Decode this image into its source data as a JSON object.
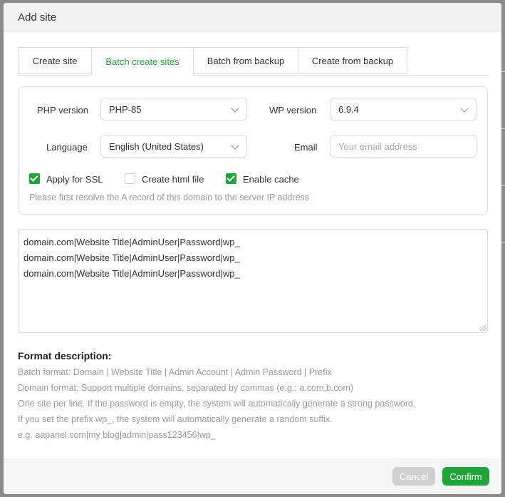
{
  "dialog": {
    "title": "Add site"
  },
  "tabs": [
    "Create site",
    "Batch create sites",
    "Batch from backup",
    "Create from backup"
  ],
  "form": {
    "php_label": "PHP version",
    "php_value": "PHP-85",
    "wp_label": "WP version",
    "wp_value": "6.9.4",
    "lang_label": "Language",
    "lang_value": "English (United States)",
    "email_label": "Email",
    "email_placeholder": "Your email address",
    "ssl_label": "Apply for SSL",
    "ssl_checked": true,
    "html_label": "Create html file",
    "html_checked": false,
    "cache_label": "Enable cache",
    "cache_checked": true,
    "hint": "Please first resolve the A record of this domain to the server IP address"
  },
  "batch_lines": [
    "domain.com|Website Title|AdminUser|Password|wp_",
    "domain.com|Website Title|AdminUser|Password|wp_",
    "domain.com|Website Title|AdminUser|Password|wp_"
  ],
  "format": {
    "title": "Format description:",
    "lines": [
      "Batch format: Domain | Website Title | Admin Account | Admin Password | Prefix",
      "Domain format: Support multiple domains, separated by commas (e.g.: a.com,b.com)",
      "One site per line. If the password is empty, the system will automatically generate a strong password.",
      "If you set the prefix wp_, the system will automatically generate a random suffix.",
      "e.g. aapanel.com|my blog|admin|pass123456|wp_"
    ]
  },
  "footer": {
    "cancel": "Cancel",
    "confirm": "Confirm"
  },
  "colors": {
    "accent": "#20a53a",
    "disabled": "#cfcfcf"
  }
}
